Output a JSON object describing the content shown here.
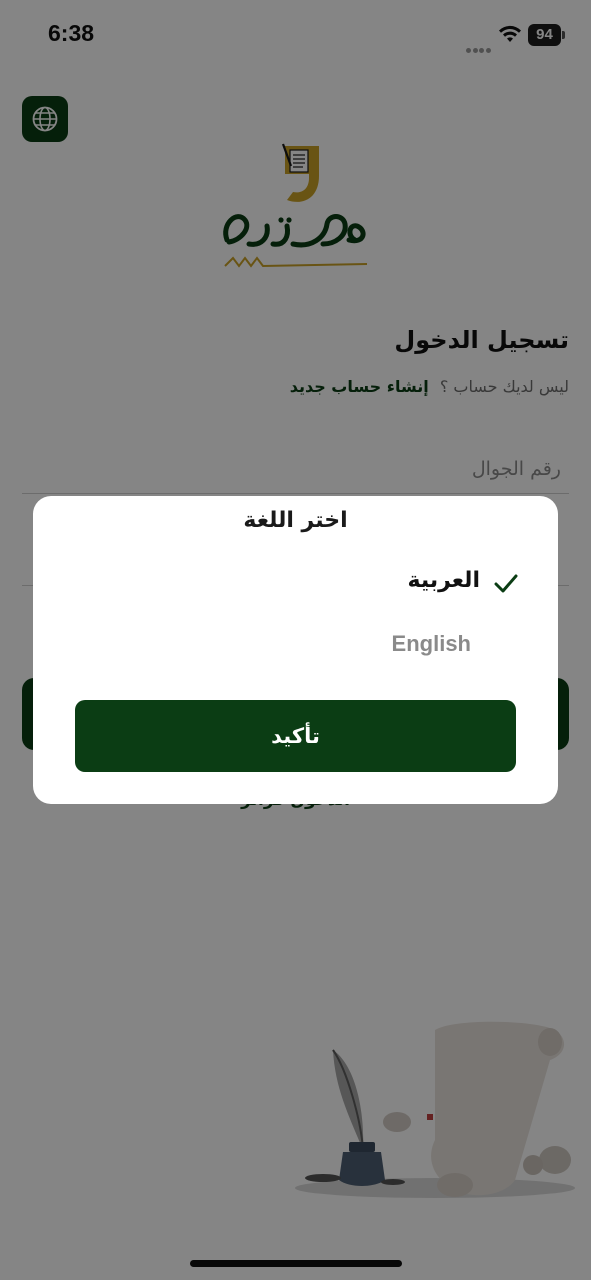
{
  "status_bar": {
    "time": "6:38",
    "battery": "94"
  },
  "login": {
    "title": "تسجيل الدخول",
    "no_account_text": "ليس لديك حساب ؟",
    "signup_link": "إنشاء حساب جديد",
    "phone_placeholder": "رقم الجوال",
    "guest_link": "الدخول كزائر"
  },
  "language_dialog": {
    "title": "اختر اللغة",
    "options": [
      {
        "label": "العربية",
        "selected": true
      },
      {
        "label": "English",
        "selected": false
      }
    ],
    "confirm_label": "تأكيد"
  },
  "icons": {
    "globe": "globe-icon",
    "check": "check-icon",
    "wifi": "wifi-icon"
  },
  "colors": {
    "primary": "#0b3d14",
    "logo_gold": "#c9a227",
    "overlay": "rgba(0,0,0,0.48)"
  }
}
